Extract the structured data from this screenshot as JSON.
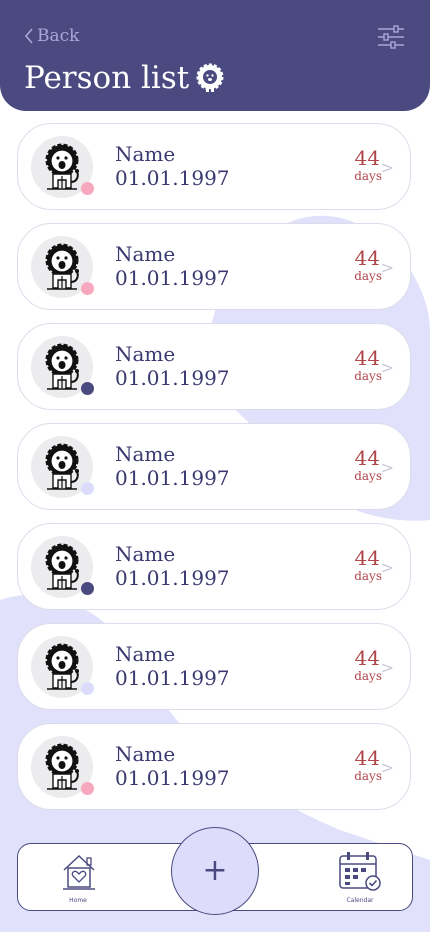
{
  "header": {
    "back_label": "Back",
    "title": "Person list"
  },
  "people": [
    {
      "name": "Name",
      "date": "01.01.1997",
      "days_value": "44",
      "days_label": "days",
      "dot_color": "#f7a8bf"
    },
    {
      "name": "Name",
      "date": "01.01.1997",
      "days_value": "44",
      "days_label": "days",
      "dot_color": "#f7a8bf"
    },
    {
      "name": "Name",
      "date": "01.01.1997",
      "days_value": "44",
      "days_label": "days",
      "dot_color": "#4b4a80"
    },
    {
      "name": "Name",
      "date": "01.01.1997",
      "days_value": "44",
      "days_label": "days",
      "dot_color": "#dcdbfb"
    },
    {
      "name": "Name",
      "date": "01.01.1997",
      "days_value": "44",
      "days_label": "days",
      "dot_color": "#4b4a80"
    },
    {
      "name": "Name",
      "date": "01.01.1997",
      "days_value": "44",
      "days_label": "days",
      "dot_color": "#dcdbfb"
    },
    {
      "name": "Name",
      "date": "01.01.1997",
      "days_value": "44",
      "days_label": "days",
      "dot_color": "#f7a8bf"
    }
  ],
  "nav": {
    "home_label": "Home",
    "calendar_label": "Calendar",
    "add_label": "+"
  },
  "colors": {
    "primary": "#4b4a80",
    "accent_light": "#dddcfb",
    "days_red": "#b0464a",
    "pink": "#f7a8bf"
  },
  "icons": {
    "back": "chevron-left-icon",
    "filter": "sliders-icon",
    "title": "lion-icon",
    "avatar": "lion-avatar-icon",
    "home": "house-heart-icon",
    "calendar": "calendar-check-icon",
    "add": "plus-icon"
  }
}
